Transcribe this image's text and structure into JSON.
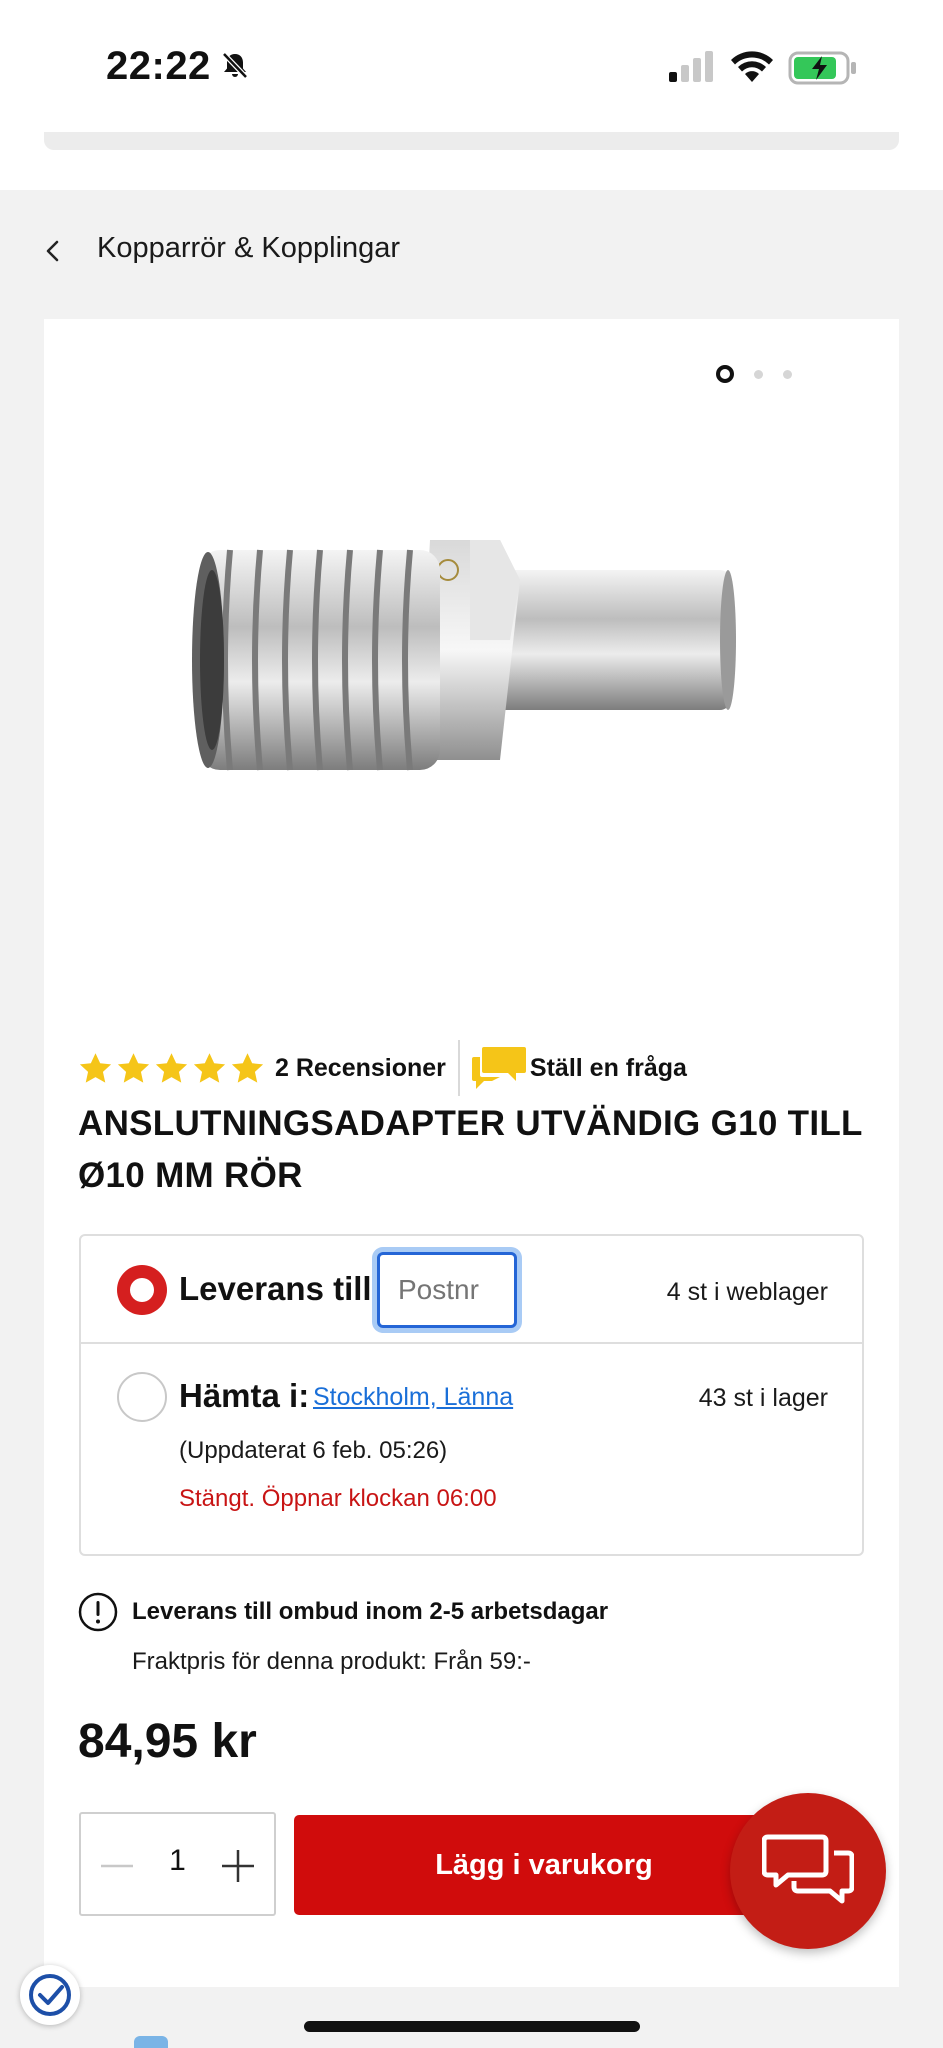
{
  "status_bar": {
    "time": "22:22",
    "icons": [
      "bell-slash-icon",
      "cellular-signal-icon",
      "wifi-icon",
      "battery-charging-icon"
    ]
  },
  "breadcrumb": {
    "back_icon": "chevron-left-icon",
    "label": "Kopparrör & Kopplingar"
  },
  "gallery": {
    "image_count": 3,
    "active_index": 0
  },
  "rating": {
    "stars": 5,
    "reviews_label": "2 Recensioner",
    "ask_label": "Ställ en fråga",
    "ask_icon": "speech-bubbles-icon"
  },
  "product": {
    "title": "ANSLUTNINGSADAPTER UTVÄNDIG G10 TILL Ø10 MM RÖR",
    "price": "84,95 kr"
  },
  "delivery": {
    "label": "Leverans till:",
    "postnr_placeholder": "Postnr",
    "web_stock": "4 st i weblager",
    "pickup_label": "Hämta i:",
    "store": "Stockholm, Länna",
    "store_stock": "43 st i lager",
    "updated": "(Uppdaterat 6 feb. 05:26)",
    "closed_notice": "Stängt. Öppnar klockan 06:00",
    "selected_option": "delivery"
  },
  "shipping_info": {
    "icon": "exclamation-circle-icon",
    "title": "Leverans till ombud inom 2-5 arbetsdagar",
    "price_text": "Fraktpris för denna produkt: Från 59:-"
  },
  "cart": {
    "quantity": "1",
    "add_label": "Lägg i varukorg"
  },
  "colors": {
    "accent_red": "#d00c0c",
    "chat_red": "#c31d15",
    "star_yellow": "#f5c518",
    "link_blue": "#1a6fd8",
    "focus_blue": "#2465d6"
  }
}
